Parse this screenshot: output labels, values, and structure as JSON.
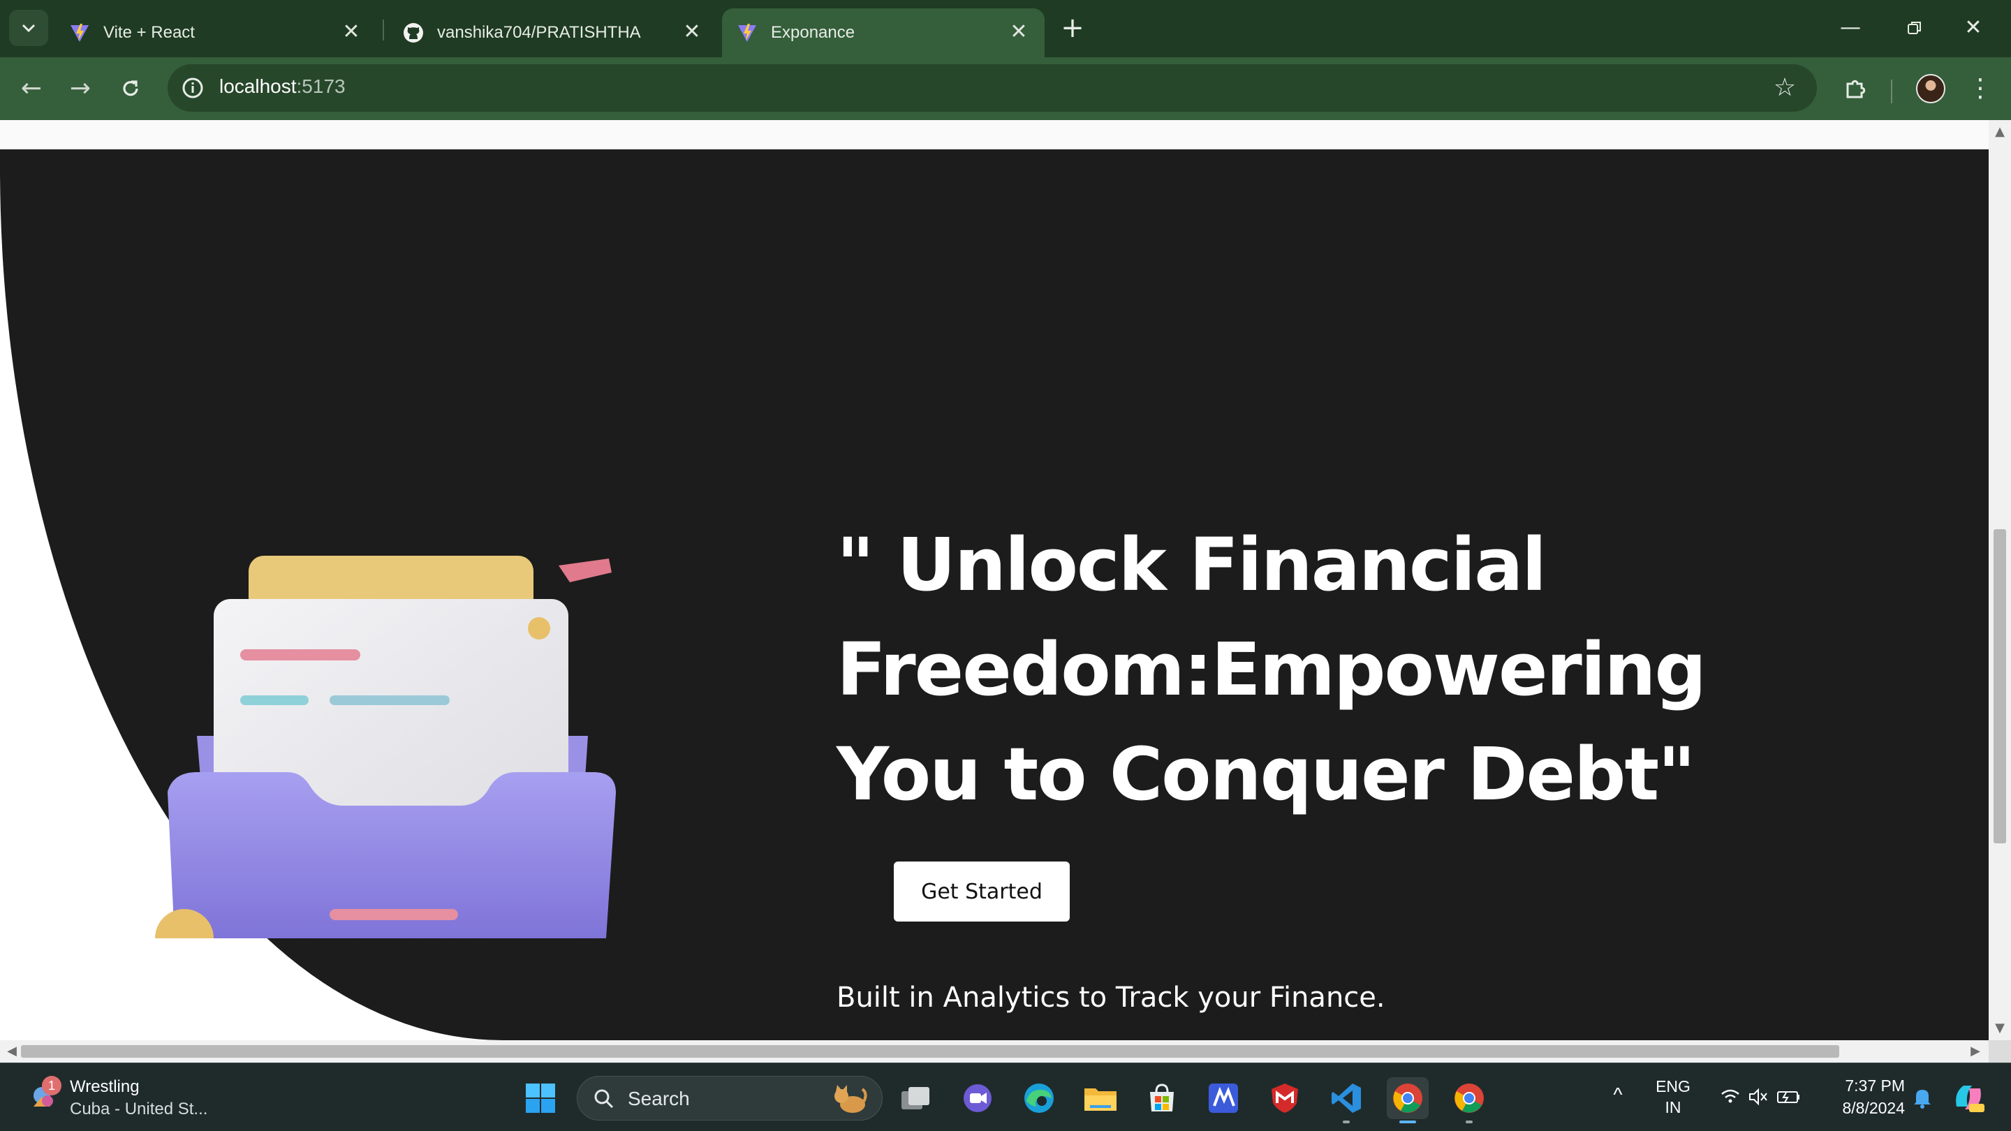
{
  "browser": {
    "tabs": [
      {
        "title": "Vite + React",
        "favicon": "vite-icon",
        "active": false
      },
      {
        "title": "vanshika704/PRATISHTHA",
        "favicon": "github-icon",
        "active": false
      },
      {
        "title": "Exponance",
        "favicon": "vite-icon",
        "active": true
      }
    ],
    "new_tab_label": "+",
    "address": {
      "host": "localhost",
      "port": ":5173"
    },
    "colors": {
      "frame": "#1f3b23",
      "toolbar": "#355e3a",
      "omnibox": "#27472b"
    }
  },
  "page": {
    "headline": "\" Unlock Financial Freedom:Empowering You to Conquer Debt\"",
    "cta_label": "Get Started",
    "subtext": "Built in Analytics to Track your Finance.",
    "illustration": "document-tray-illustration",
    "colors": {
      "hero_bg": "#1c1c1c",
      "page_bg": "#ffffff",
      "tray": "#8f86e0",
      "card_top": "#e8c97a"
    }
  },
  "taskbar": {
    "weather": {
      "badge": "1",
      "title": "Wrestling",
      "subtitle": "Cuba - United St..."
    },
    "search_label": "Search",
    "apps": [
      "windows-start-icon",
      "task-view-icon",
      "meet-icon",
      "edge-icon",
      "file-explorer-icon",
      "store-icon",
      "app-m-icon",
      "mcafee-icon",
      "vscode-icon",
      "chrome-icon",
      "chrome-icon"
    ],
    "language": {
      "line1": "ENG",
      "line2": "IN"
    },
    "time": "7:37 PM",
    "date": "8/8/2024"
  }
}
